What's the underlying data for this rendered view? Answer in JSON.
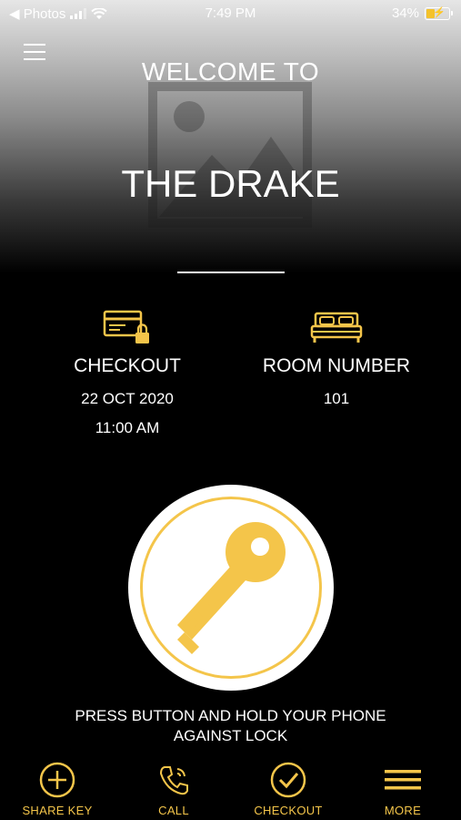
{
  "status_bar": {
    "back_app": "◀ Photos",
    "time": "7:49 PM",
    "battery": "34%"
  },
  "header": {
    "welcome": "WELCOME TO",
    "hotel_name": "THE DRAKE"
  },
  "checkout_info": {
    "title": "CHECKOUT",
    "date": "22 OCT 2020",
    "time": "11:00 AM"
  },
  "room_info": {
    "title": "ROOM NUMBER",
    "number": "101"
  },
  "unlock": {
    "instruction_line1": "PRESS BUTTON AND HOLD YOUR PHONE",
    "instruction_line2": "AGAINST LOCK"
  },
  "tabs": [
    {
      "label": "SHARE KEY",
      "icon": "plus-circle-icon"
    },
    {
      "label": "CALL",
      "icon": "phone-icon"
    },
    {
      "label": "CHECKOUT",
      "icon": "check-circle-icon"
    },
    {
      "label": "MORE",
      "icon": "menu-icon"
    }
  ],
  "colors": {
    "accent": "#f4c54a",
    "background": "#000000",
    "text": "#ffffff"
  }
}
